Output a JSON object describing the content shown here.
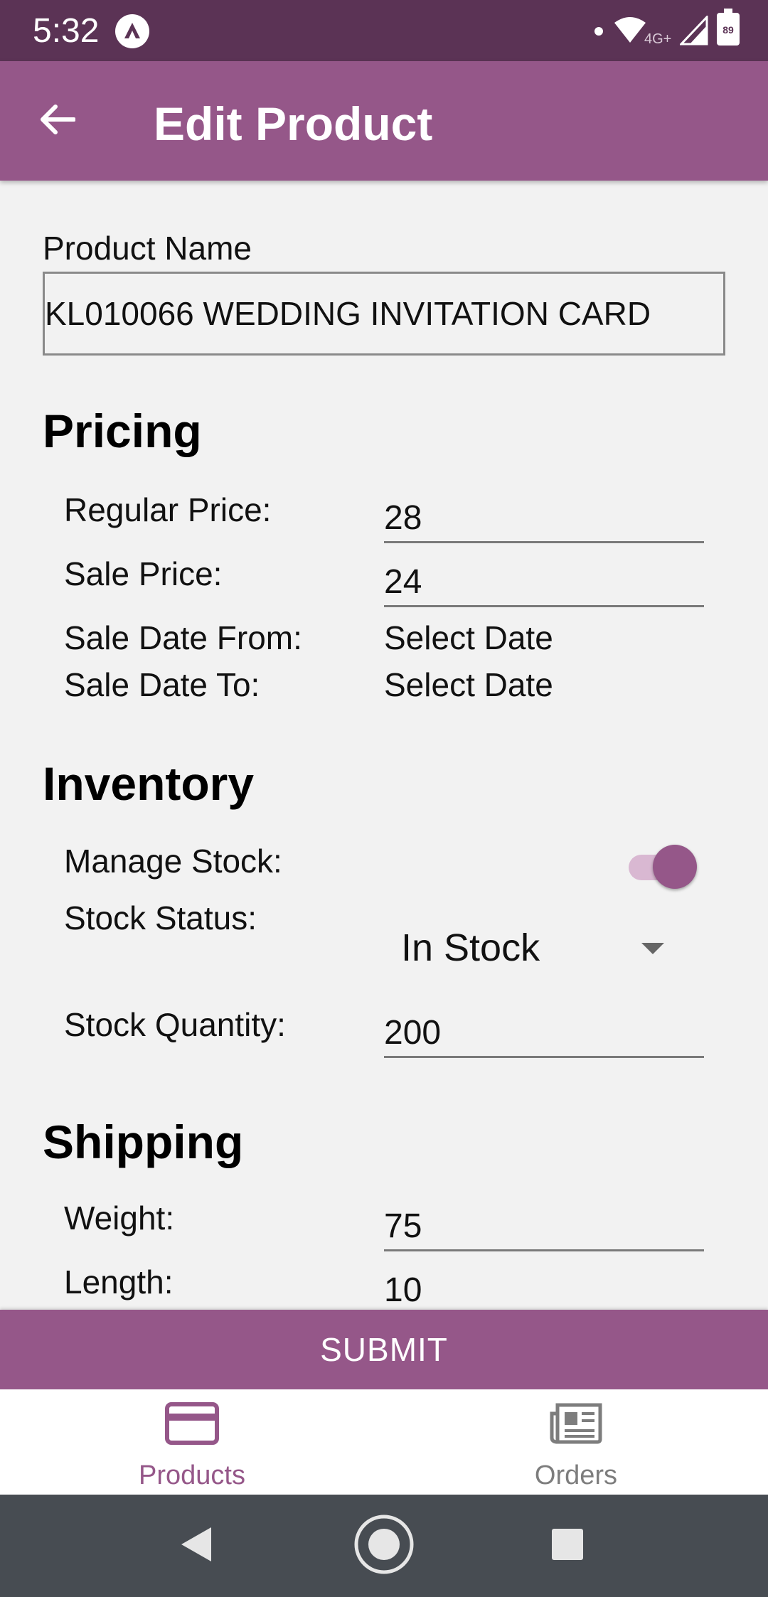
{
  "status_bar": {
    "time": "5:32",
    "network_label": "4G+",
    "battery_level": "89",
    "icons": [
      "app-notification-icon",
      "wifi-icon",
      "signal-icon",
      "battery-icon"
    ]
  },
  "app_bar": {
    "title": "Edit Product",
    "back_icon": "arrow-left-icon"
  },
  "form": {
    "product_name_label": "Product Name",
    "product_name_value": "KL010066 WEDDING INVITATION CARD",
    "pricing": {
      "title": "Pricing",
      "regular_price_label": "Regular Price:",
      "regular_price_value": "28",
      "sale_price_label": "Sale Price:",
      "sale_price_value": "24",
      "sale_date_from_label": "Sale Date From:",
      "sale_date_from_value": "Select Date",
      "sale_date_to_label": "Sale Date To:",
      "sale_date_to_value": "Select Date"
    },
    "inventory": {
      "title": "Inventory",
      "manage_stock_label": "Manage Stock:",
      "manage_stock_on": true,
      "stock_status_label": "Stock Status:",
      "stock_status_value": "In Stock",
      "stock_quantity_label": "Stock Quantity:",
      "stock_quantity_value": "200"
    },
    "shipping": {
      "title": "Shipping",
      "weight_label": "Weight:",
      "weight_value": "75",
      "length_label": "Length:",
      "length_value": "10"
    },
    "submit_label": "SUBMIT"
  },
  "bottom_nav": {
    "items": [
      {
        "label": "Products",
        "icon": "credit-card-icon",
        "active": true
      },
      {
        "label": "Orders",
        "icon": "newspaper-icon",
        "active": false
      }
    ]
  },
  "colors": {
    "status_bar": "#5b3355",
    "primary": "#955789",
    "background": "#f2f2f2",
    "system_nav": "#474c52"
  }
}
